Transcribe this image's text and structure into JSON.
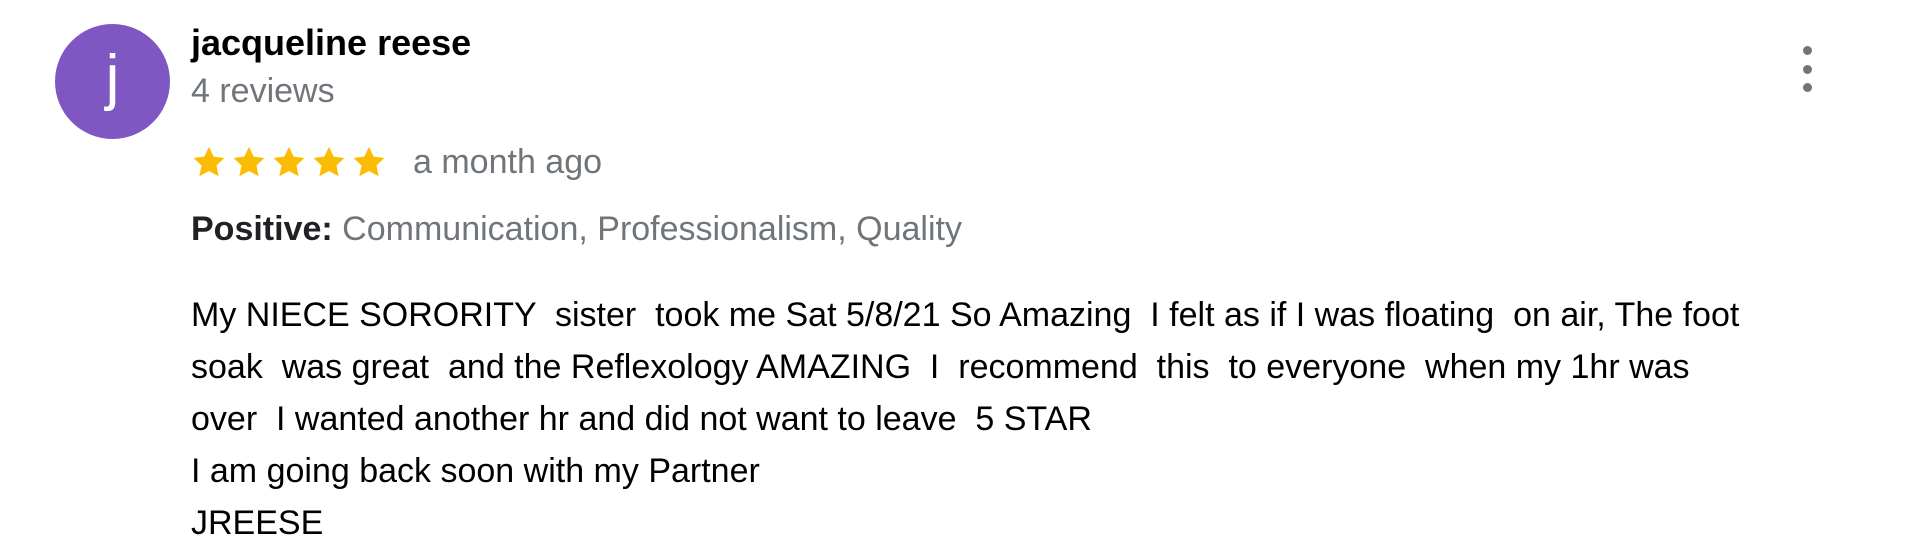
{
  "reviewer": {
    "avatar_letter": "j",
    "avatar_color": "#7e57c2",
    "name": "jacqueline reese",
    "review_count": "4 reviews"
  },
  "menu": {
    "icon": "more-vert-icon"
  },
  "rating": {
    "stars": 5,
    "max_stars": 5,
    "star_color": "#fbbc04",
    "star_icon": "star-icon",
    "time_ago": "a month ago"
  },
  "highlights": {
    "label": "Positive:",
    "values": "Communication, Professionalism, Quality"
  },
  "review_text": {
    "lines": [
      "My NIECE SORORITY  sister  took me Sat 5/8/21 So Amazing  I felt as if I was floating  on air, The foot",
      "soak  was great  and the Reflexology AMAZING  I  recommend  this  to everyone  when my 1hr was",
      "over  I wanted another hr and did not want to leave  5 STAR",
      "I am going back soon with my Partner",
      "JREESE"
    ]
  }
}
